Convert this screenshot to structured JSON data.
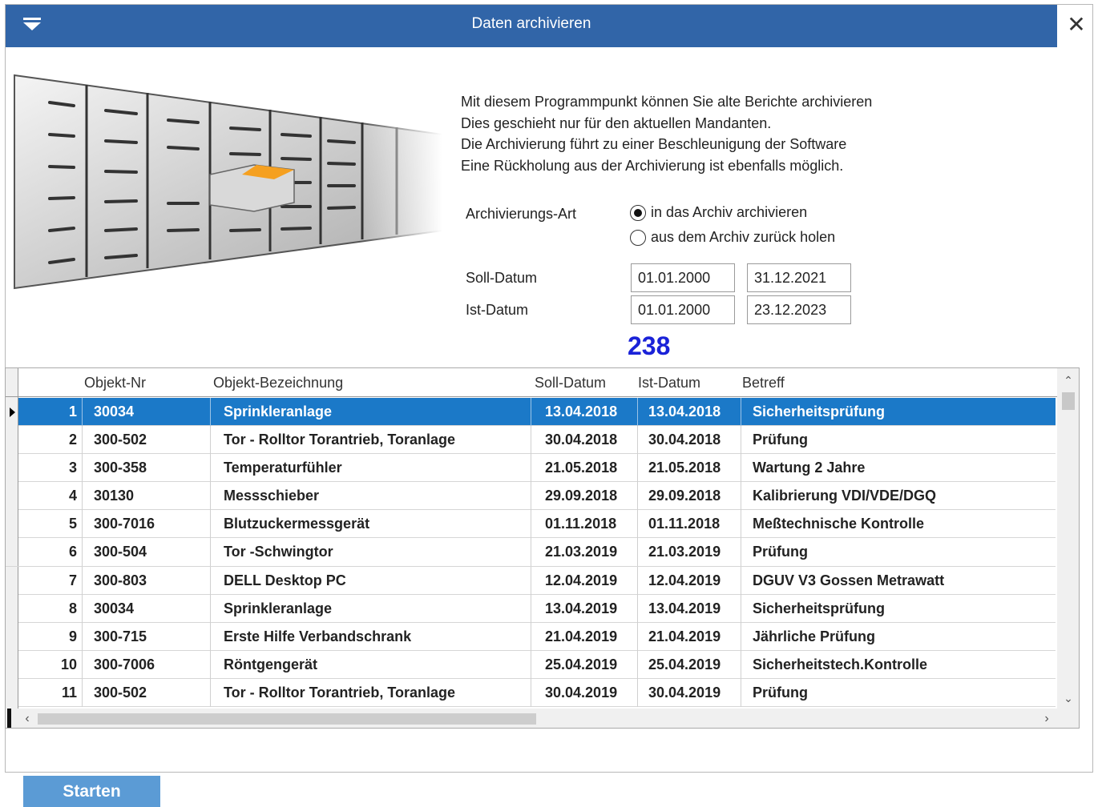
{
  "window": {
    "title": "Daten archivieren"
  },
  "info": {
    "line1": "Mit diesem Programmpunkt können Sie alte Berichte archivieren",
    "line2": "Dies geschieht nur für den aktuellen Mandanten.",
    "line3": "Die Archivierung führt zu einer Beschleunigung der Software",
    "line4": "Eine Rückholung aus der Archivierung ist ebenfalls möglich."
  },
  "form": {
    "archive_type_label": "Archivierungs-Art",
    "radio1_label": "in das Archiv archivieren",
    "radio2_label": "aus dem Archiv zurück holen",
    "selected_radio": "radio1",
    "soll_label": "Soll-Datum",
    "ist_label": "Ist-Datum",
    "soll_from": "01.01.2000",
    "soll_to": "31.12.2021",
    "ist_from": "01.01.2000",
    "ist_to": "23.12.2023",
    "count": "238"
  },
  "grid": {
    "headers": [
      "Objekt-Nr",
      "Objekt-Bezeichnung",
      "Soll-Datum",
      "Ist-Datum",
      "Betreff"
    ],
    "rows": [
      [
        "1",
        "30034",
        "Sprinkleranlage",
        "13.04.2018",
        "13.04.2018",
        "Sicherheitsprüfung"
      ],
      [
        "2",
        "300-502",
        "Tor - Rolltor  Torantrieb, Toranlage",
        "30.04.2018",
        "30.04.2018",
        "Prüfung"
      ],
      [
        "3",
        "300-358",
        "Temperaturfühler",
        "21.05.2018",
        "21.05.2018",
        "Wartung 2 Jahre"
      ],
      [
        "4",
        "30130",
        "Messschieber",
        "29.09.2018",
        "29.09.2018",
        "Kalibrierung VDI/VDE/DGQ"
      ],
      [
        "5",
        "300-7016",
        "Blutzuckermessgerät",
        "01.11.2018",
        "01.11.2018",
        "Meßtechnische Kontrolle"
      ],
      [
        "6",
        "300-504",
        "Tor -Schwingtor",
        "21.03.2019",
        "21.03.2019",
        "Prüfung"
      ],
      [
        "7",
        "300-803",
        "DELL Desktop PC",
        "12.04.2019",
        "12.04.2019",
        "DGUV V3 Gossen Metrawatt"
      ],
      [
        "8",
        "30034",
        "Sprinkleranlage",
        "13.04.2019",
        "13.04.2019",
        "Sicherheitsprüfung"
      ],
      [
        "9",
        "300-715",
        "Erste Hilfe Verbandschrank",
        "21.04.2019",
        "21.04.2019",
        "Jährliche Prüfung"
      ],
      [
        "10",
        "300-7006",
        "Röntgengerät",
        "25.04.2019",
        "25.04.2019",
        "Sicherheitstech.Kontrolle"
      ],
      [
        "11",
        "300-502",
        "Tor - Rolltor  Torantrieb, Toranlage",
        "30.04.2019",
        "30.04.2019",
        "Prüfung"
      ]
    ],
    "selected_row": 0
  },
  "buttons": {
    "start": "Starten"
  },
  "colors": {
    "titlebar": "#3165a8",
    "selection": "#1b79c8",
    "count": "#1a22d8",
    "start_button": "#5b9bd5"
  },
  "icons": {
    "menu": "menu-dropdown-icon",
    "close": "close-icon",
    "illustration": "filing-cabinet-illustration"
  }
}
